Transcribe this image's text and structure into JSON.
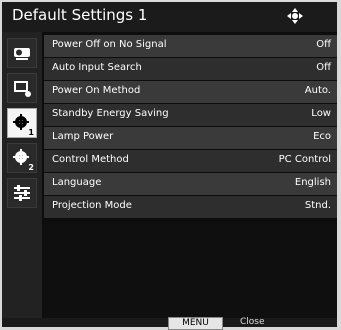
{
  "window": {
    "title": "Default Settings 1"
  },
  "sidebar": {
    "items": [
      {
        "icon": "projector-icon",
        "sub": ""
      },
      {
        "icon": "screen-settings-icon",
        "sub": ""
      },
      {
        "icon": "gear-icon",
        "sub": "1"
      },
      {
        "icon": "gear-icon",
        "sub": "2"
      },
      {
        "icon": "sliders-icon",
        "sub": ""
      }
    ]
  },
  "menu": {
    "rows": [
      {
        "label": "Power Off on No Signal",
        "value": "Off"
      },
      {
        "label": "Auto Input Search",
        "value": "Off"
      },
      {
        "label": "Power On Method",
        "value": "Auto."
      },
      {
        "label": "Standby Energy Saving",
        "value": "Low"
      },
      {
        "label": "Lamp Power",
        "value": "Eco"
      },
      {
        "label": "Control Method",
        "value": "PC Control"
      },
      {
        "label": "Language",
        "value": "English"
      },
      {
        "label": "Projection Mode",
        "value": "Stnd."
      }
    ]
  },
  "footer": {
    "menu_label": "MENU",
    "close_label": "Close"
  }
}
